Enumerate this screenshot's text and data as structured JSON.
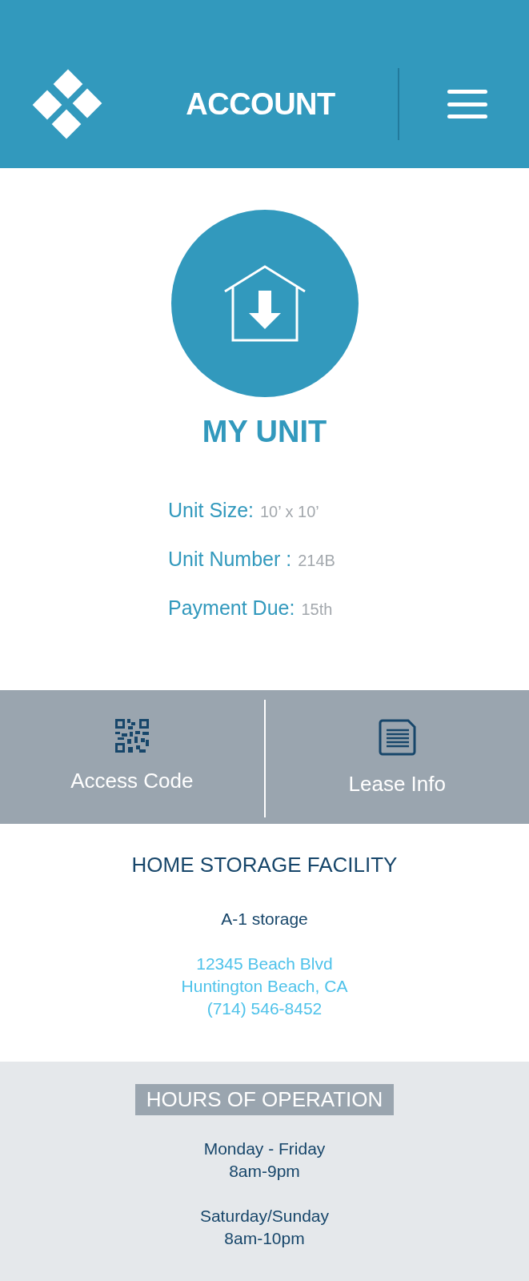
{
  "header": {
    "title": "ACCOUNT"
  },
  "unit": {
    "title": "MY UNIT",
    "details": [
      {
        "label": "Unit Size:",
        "value": "10’ x 10’"
      },
      {
        "label": "Unit Number :",
        "value": "214B"
      },
      {
        "label": "Payment Due:",
        "value": "15th"
      }
    ]
  },
  "actions": [
    {
      "kind": "qr",
      "label": "Access Code"
    },
    {
      "kind": "document",
      "label": "Lease Info"
    }
  ],
  "facility": {
    "heading": "HOME STORAGE FACILITY",
    "name": "A-1 storage",
    "address_lines": [
      "12345 Beach Blvd",
      "Huntington Beach, CA"
    ],
    "phone": "(714) 546-8452"
  },
  "hours": {
    "heading": "HOURS OF OPERATION",
    "groups": [
      {
        "days": "Monday - Friday",
        "time": "8am-9pm"
      },
      {
        "days": "Saturday/Sunday",
        "time": "8am-10pm"
      }
    ]
  }
}
